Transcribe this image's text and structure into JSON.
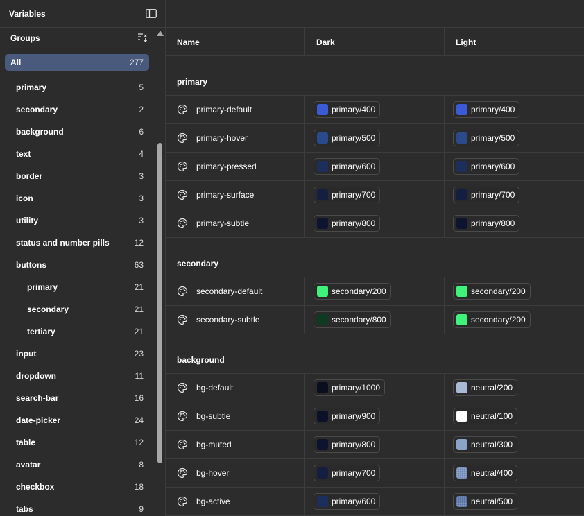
{
  "sidebar": {
    "title": "Variables",
    "groups_heading": "Groups",
    "groups": [
      {
        "label": "All",
        "count": "277",
        "level": 0,
        "active": true
      },
      {
        "label": "primary",
        "count": "5",
        "level": 1
      },
      {
        "label": "secondary",
        "count": "2",
        "level": 1
      },
      {
        "label": "background",
        "count": "6",
        "level": 1
      },
      {
        "label": "text",
        "count": "4",
        "level": 1
      },
      {
        "label": "border",
        "count": "3",
        "level": 1
      },
      {
        "label": "icon",
        "count": "3",
        "level": 1
      },
      {
        "label": "utility",
        "count": "3",
        "level": 1
      },
      {
        "label": "status and number pills",
        "count": "12",
        "level": 1
      },
      {
        "label": "buttons",
        "count": "63",
        "level": 1
      },
      {
        "label": "primary",
        "count": "21",
        "level": 2
      },
      {
        "label": "secondary",
        "count": "21",
        "level": 2
      },
      {
        "label": "tertiary",
        "count": "21",
        "level": 2
      },
      {
        "label": "input",
        "count": "23",
        "level": 1
      },
      {
        "label": "dropdown",
        "count": "11",
        "level": 1
      },
      {
        "label": "search-bar",
        "count": "16",
        "level": 1
      },
      {
        "label": "date-picker",
        "count": "24",
        "level": 1
      },
      {
        "label": "table",
        "count": "12",
        "level": 1
      },
      {
        "label": "avatar",
        "count": "8",
        "level": 1
      },
      {
        "label": "checkbox",
        "count": "18",
        "level": 1
      },
      {
        "label": "tabs",
        "count": "9",
        "level": 1
      }
    ]
  },
  "table": {
    "columns": {
      "name": "Name",
      "dark": "Dark",
      "light": "Light"
    },
    "sections": [
      {
        "label": "primary",
        "rows": [
          {
            "name": "primary-default",
            "dark": {
              "text": "primary/400",
              "color": "#3b5bd6"
            },
            "light": {
              "text": "primary/400",
              "color": "#3b5bd6"
            }
          },
          {
            "name": "primary-hover",
            "dark": {
              "text": "primary/500",
              "color": "#2a4a8c"
            },
            "light": {
              "text": "primary/500",
              "color": "#2a4a8c"
            }
          },
          {
            "name": "primary-pressed",
            "dark": {
              "text": "primary/600",
              "color": "#1c2e5c"
            },
            "light": {
              "text": "primary/600",
              "color": "#1c2e5c"
            }
          },
          {
            "name": "primary-surface",
            "dark": {
              "text": "primary/700",
              "color": "#141e40"
            },
            "light": {
              "text": "primary/700",
              "color": "#141e40"
            }
          },
          {
            "name": "primary-subtle",
            "dark": {
              "text": "primary/800",
              "color": "#0d1430"
            },
            "light": {
              "text": "primary/800",
              "color": "#0d1430"
            }
          }
        ]
      },
      {
        "label": "secondary",
        "rows": [
          {
            "name": "secondary-default",
            "dark": {
              "text": "secondary/200",
              "color": "#3ef27a"
            },
            "light": {
              "text": "secondary/200",
              "color": "#3ef27a"
            }
          },
          {
            "name": "secondary-subtle",
            "dark": {
              "text": "secondary/800",
              "color": "#0e3a22"
            },
            "light": {
              "text": "secondary/200",
              "color": "#3ef27a"
            }
          }
        ]
      },
      {
        "label": "background",
        "rows": [
          {
            "name": "bg-default",
            "dark": {
              "text": "primary/1000",
              "color": "#0a0f20"
            },
            "light": {
              "text": "neutral/200",
              "color": "#a9b9d6"
            }
          },
          {
            "name": "bg-subtle",
            "dark": {
              "text": "primary/900",
              "color": "#0b1128"
            },
            "light": {
              "text": "neutral/100",
              "color": "#ffffff"
            }
          },
          {
            "name": "bg-muted",
            "dark": {
              "text": "primary/800",
              "color": "#0d1430"
            },
            "light": {
              "text": "neutral/300",
              "color": "#8aa3c8"
            }
          },
          {
            "name": "bg-hover",
            "dark": {
              "text": "primary/700",
              "color": "#141e40"
            },
            "light": {
              "text": "neutral/400",
              "color": "#6f8ab8",
              "dotted": true
            }
          },
          {
            "name": "bg-active",
            "dark": {
              "text": "primary/600",
              "color": "#1c2e5c"
            },
            "light": {
              "text": "neutral/500",
              "color": "#5874a6",
              "dotted": true
            }
          }
        ]
      }
    ]
  }
}
